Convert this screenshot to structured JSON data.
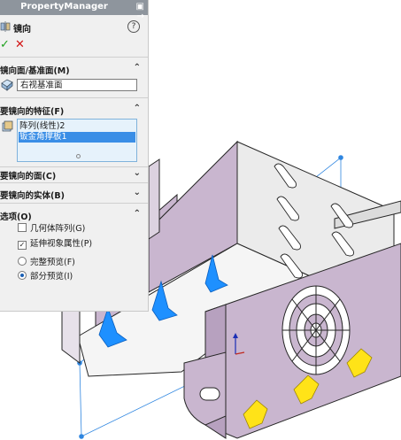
{
  "property_manager": {
    "header_title": "PropertyManager",
    "pin_glyph": "▣ →",
    "feature_name": "镜向",
    "help_glyph": "?",
    "ok_glyph": "✓",
    "cancel_glyph": "✕",
    "mirror_plane_group": {
      "label": "镜向面/基准面(M)",
      "value": "右视基准面"
    },
    "features_group": {
      "label": "要镜向的特征(F)",
      "items": [
        "阵列(线性)2",
        "钣金角撑板1"
      ],
      "selected_index": 1
    },
    "faces_group": {
      "label": "要镜向的面(C)"
    },
    "bodies_group": {
      "label": "要镜向的实体(B)"
    },
    "options_group": {
      "label": "选项(O)",
      "geometry_pattern": {
        "label": "几何体阵列(G)",
        "checked": false
      },
      "propagate_visual": {
        "label": "延伸视象属性(P)",
        "checked": true
      },
      "full_preview": {
        "label": "完整预览(F)",
        "selected": false
      },
      "partial_preview": {
        "label": "部分预览(I)",
        "selected": true
      }
    }
  },
  "colors": {
    "panel_bg": "#f0f0f0",
    "header_bg": "#8e959d",
    "sheet_face": "#c9b6cf",
    "sheet_face_dark": "#b7a1bf",
    "sheet_edge": "#262626",
    "preview_gusset": "#ffe318",
    "selected_gusset": "#1e90ff",
    "plane_line": "#2f86e0",
    "list_select": "#3a8ee6"
  }
}
